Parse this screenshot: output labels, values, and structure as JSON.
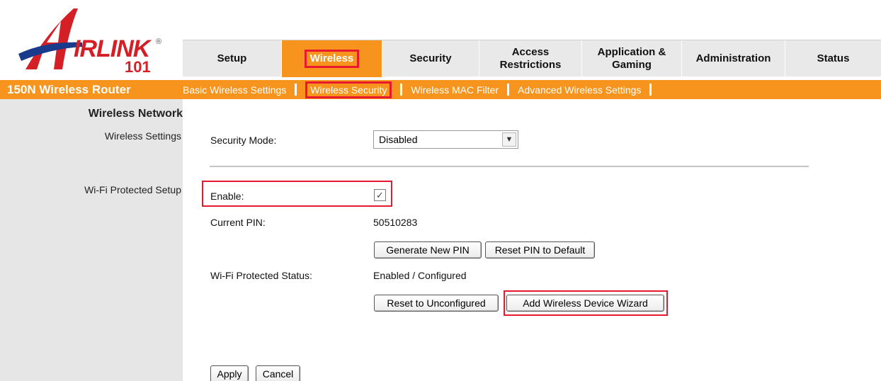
{
  "logo": {
    "word": "IRLINK",
    "letter_a": "A",
    "registered": "®",
    "number": "101"
  },
  "tabs": [
    {
      "label": "Setup",
      "active": false
    },
    {
      "label": "Wireless",
      "active": true
    },
    {
      "label": "Security",
      "active": false
    },
    {
      "label": "Access\nRestrictions",
      "active": false
    },
    {
      "label": "Application &\nGaming",
      "active": false
    },
    {
      "label": "Administration",
      "active": false
    },
    {
      "label": "Status",
      "active": false
    }
  ],
  "product_name": "150N Wireless Router",
  "subnav": [
    {
      "label": "Basic Wireless Settings",
      "active": false
    },
    {
      "label": "Wireless Security",
      "active": true
    },
    {
      "label": "Wireless MAC Filter",
      "active": false
    },
    {
      "label": "Advanced Wireless Settings",
      "active": false
    }
  ],
  "sidebar": {
    "heading": "Wireless Network",
    "wireless_settings": "Wireless Settings",
    "wps": "Wi-Fi Protected Setup"
  },
  "form": {
    "security_mode_label": "Security Mode:",
    "security_mode_value": "Disabled",
    "enable_label": "Enable:",
    "enable_checked": true,
    "current_pin_label": "Current PIN:",
    "current_pin_value": "50510283",
    "generate_pin": "Generate New PIN",
    "reset_pin": "Reset PIN to Default",
    "status_label": "Wi-Fi Protected Status:",
    "status_value": "Enabled / Configured",
    "reset_unconfigured": "Reset to Unconfigured",
    "add_wizard": "Add Wireless Device Wizard",
    "apply": "Apply",
    "cancel": "Cancel"
  },
  "colors": {
    "accent": "#f7941d",
    "highlight": "#e8182e",
    "brand_red": "#d41f26",
    "tab_bg": "#e9e9e9",
    "sidebar_bg": "#e6e6e6"
  }
}
